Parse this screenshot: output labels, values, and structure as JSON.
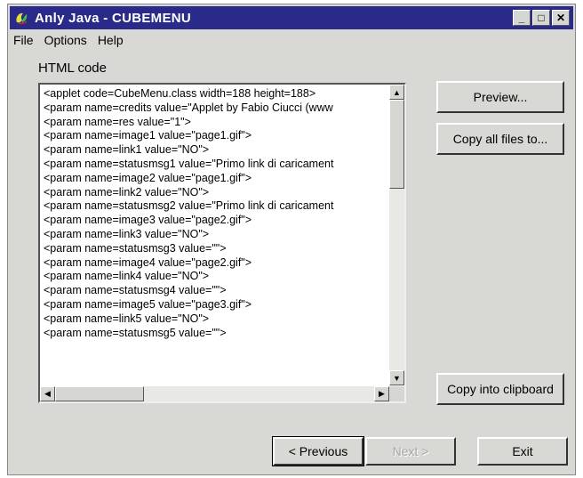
{
  "window": {
    "title": "Anly Java - CUBEMENU",
    "controls": {
      "minimize": "_",
      "maximize": "□",
      "close": "✕"
    }
  },
  "menu": [
    {
      "label": "File"
    },
    {
      "label": "Options"
    },
    {
      "label": "Help"
    }
  ],
  "html_code": {
    "label": "HTML code",
    "lines": [
      "<applet code=CubeMenu.class width=188 height=188>",
      "<param name=credits value=\"Applet by Fabio Ciucci (www",
      "<param name=res value=\"1\">",
      "<param name=image1 value=\"page1.gif\">",
      "<param name=link1 value=\"NO\">",
      "<param name=statusmsg1 value=\"Primo link di caricament",
      "<param name=image2 value=\"page1.gif\">",
      "<param name=link2 value=\"NO\">",
      "<param name=statusmsg2 value=\"Primo link di caricament",
      "<param name=image3 value=\"page2.gif\">",
      "<param name=link3 value=\"NO\">",
      "<param name=statusmsg3 value=\"\">",
      "<param name=image4 value=\"page2.gif\">",
      "<param name=link4 value=\"NO\">",
      "<param name=statusmsg4 value=\"\">",
      "<param name=image5 value=\"page3.gif\">",
      "<param name=link5 value=\"NO\">",
      "<param name=statusmsg5 value=\"\">"
    ]
  },
  "buttons": {
    "preview": "Preview...",
    "copy_all": "Copy all files to...",
    "copy_clipboard": "Copy into clipboard",
    "previous": "< Previous",
    "next": "Next >",
    "exit": "Exit"
  },
  "scroll": {
    "up": "▲",
    "down": "▼",
    "left": "◀",
    "right": "▶"
  }
}
